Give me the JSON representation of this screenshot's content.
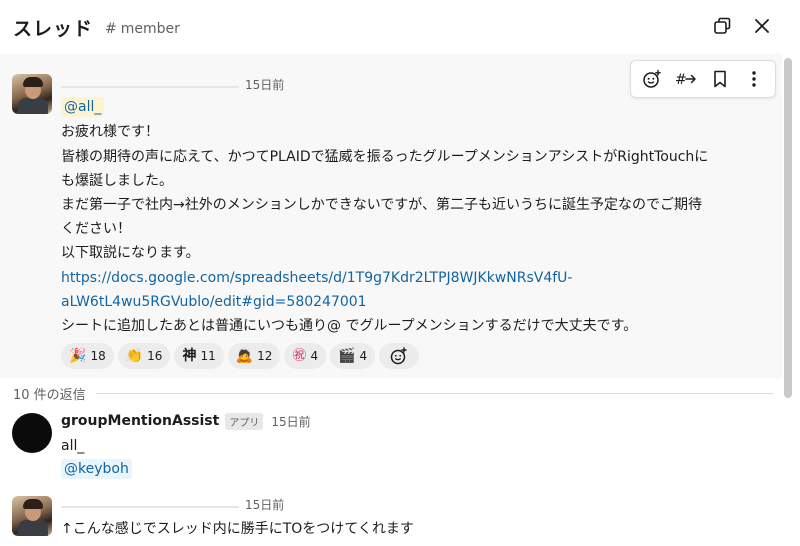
{
  "header": {
    "title": "スレッド",
    "channel": "member"
  },
  "parent": {
    "timestamp": "15日前",
    "mention": "@all_",
    "lines": [
      "お疲れ様です！",
      "皆様の期待の声に応えて、かつてPLAIDで猛威を振るったグループメンションアシストがRightTouchに",
      "も爆誕しました。",
      "まだ第一子で社内→社外のメンションしかできないですが、第二子も近いうちに誕生予定なのでご期待",
      "ください！",
      "以下取説になります。"
    ],
    "link_line1": "https://docs.google.com/spreadsheets/d/1T9g7Kdr2LTPJ8WJKkwNRsV4fU-",
    "link_line2": "aLW6tL4wu5RGVublo/edit#gid=580247001",
    "last_line": "シートに追加したあとは普通にいつも通り@ でグループメンションするだけで大丈夫です。",
    "reactions": [
      {
        "emoji": "🎉",
        "count": "18"
      },
      {
        "emoji": "👏",
        "count": "16"
      },
      {
        "emoji": "神",
        "count": "11"
      },
      {
        "emoji": "🙇",
        "count": "12"
      },
      {
        "emoji": "㊗",
        "count": "4"
      },
      {
        "emoji": "🎬",
        "count": "4"
      }
    ]
  },
  "replies_label": "10 件の返信",
  "reply1": {
    "sender": "groupMentionAssist",
    "badge": "アプリ",
    "timestamp": "15日前",
    "text": "all_",
    "mention": "@keyboh"
  },
  "reply2": {
    "timestamp": "15日前",
    "text": "↑こんな感じでスレッド内に勝手にTOをつけてくれます"
  },
  "icons": {
    "popout": "popout-icon",
    "close": "close-icon",
    "add_reaction": "add-reaction-icon",
    "forward": "forward-icon",
    "bookmark": "bookmark-icon",
    "more": "more-icon"
  },
  "colors": {
    "link": "#1264a3",
    "mention_bg": "#fdf3d1",
    "hover_bg": "#f8f8f8"
  }
}
